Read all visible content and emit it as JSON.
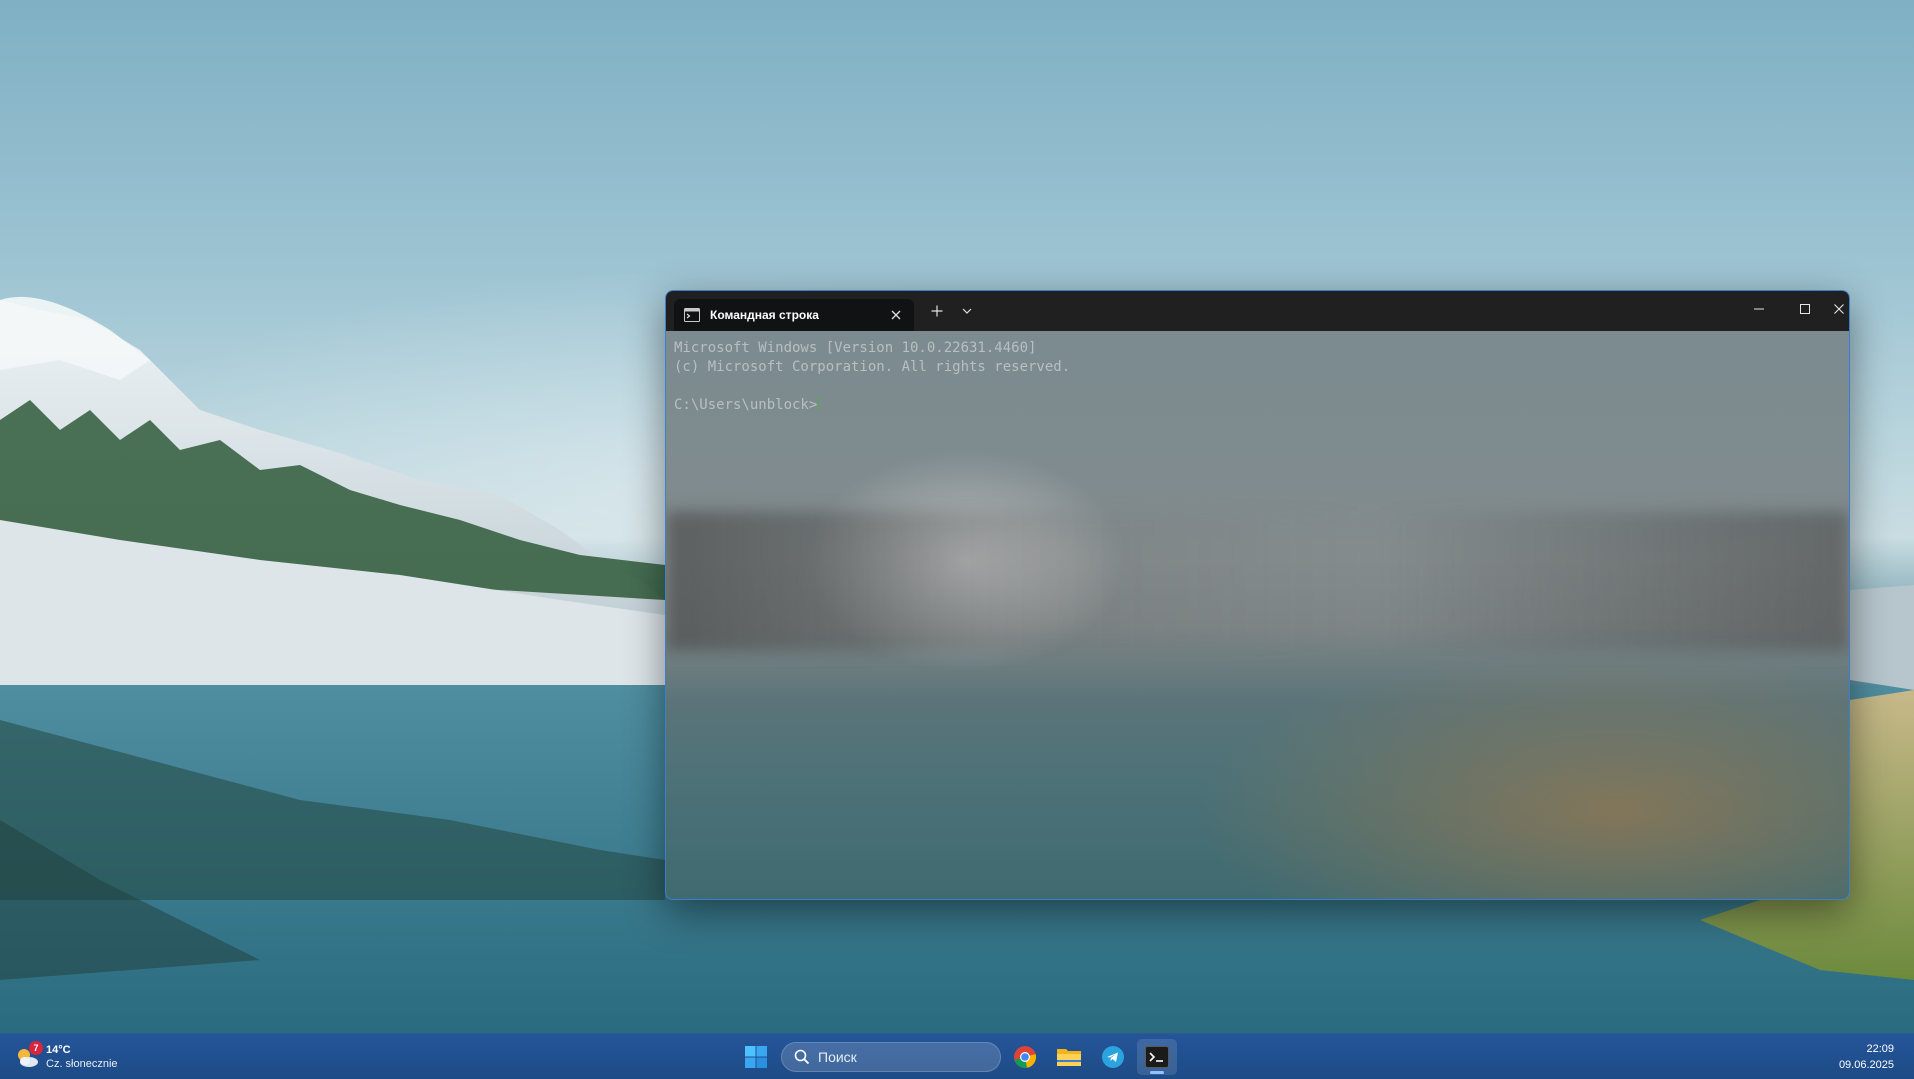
{
  "terminal": {
    "tab_title": "Командная строка",
    "lines": [
      "Microsoft Windows [Version 10.0.22631.4460]",
      "(c) Microsoft Corporation. All rights reserved.",
      "",
      "C:\\Users\\unblock>"
    ],
    "icons": {
      "tab": "cmd-icon",
      "close_tab": "close-icon",
      "new_tab": "plus-icon",
      "dropdown": "chevron-down-icon",
      "minimize": "minimize-icon",
      "maximize": "maximize-icon",
      "close_window": "close-icon"
    },
    "border_color": "#3d7fcf"
  },
  "taskbar": {
    "weather": {
      "badge": "7",
      "temperature": "14°C",
      "description": "Cz. słonecznie"
    },
    "search": {
      "placeholder": "Поиск"
    },
    "apps": [
      "start-icon",
      "chrome-icon",
      "file-explorer-icon",
      "telegram-icon",
      "terminal-icon"
    ],
    "active_app": "terminal-icon",
    "clock": {
      "time": "22:09",
      "date": "09.06.2025"
    },
    "background": "#1f4f8a"
  }
}
